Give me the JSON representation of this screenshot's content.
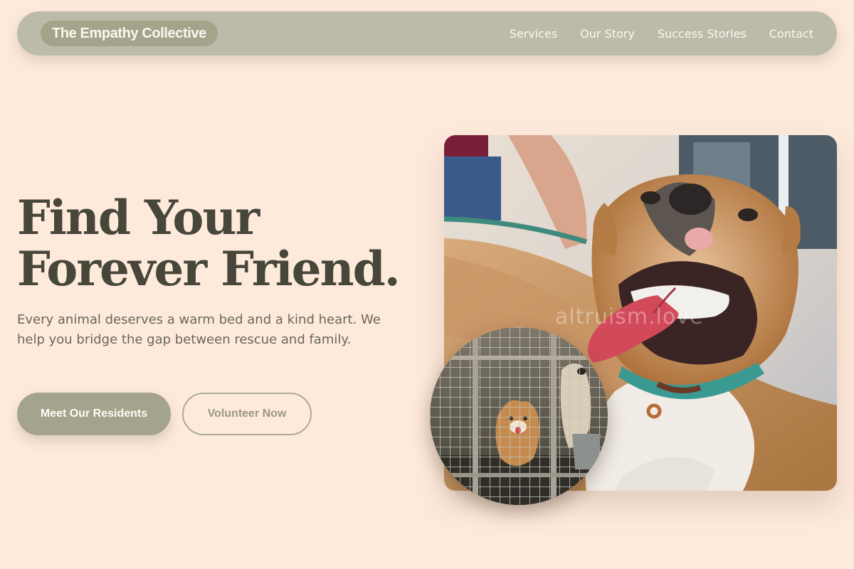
{
  "nav": {
    "brand": "The Empathy Collective",
    "links": [
      "Services",
      "Our Story",
      "Success Stories",
      "Contact"
    ]
  },
  "hero": {
    "title_line1": "Find Your",
    "title_line2": "Forever Friend.",
    "subtitle": "Every animal deserves a warm bed and a kind heart. We help you bridge the gap between rescue and family.",
    "primary_cta": "Meet Our Residents",
    "secondary_cta": "Volunteer Now"
  },
  "images": {
    "main_watermark": "altruism.love",
    "main_subject": "happy-dog-photo",
    "inset_subject": "dogs-in-kennel-photo"
  },
  "colors": {
    "page_bg": "#feeadb",
    "nav_bg": "#bcbba9",
    "brand_pill": "#a4a38b",
    "heading": "#46463b",
    "body_text": "#6a655b",
    "primary_button": "#a4a38b"
  }
}
